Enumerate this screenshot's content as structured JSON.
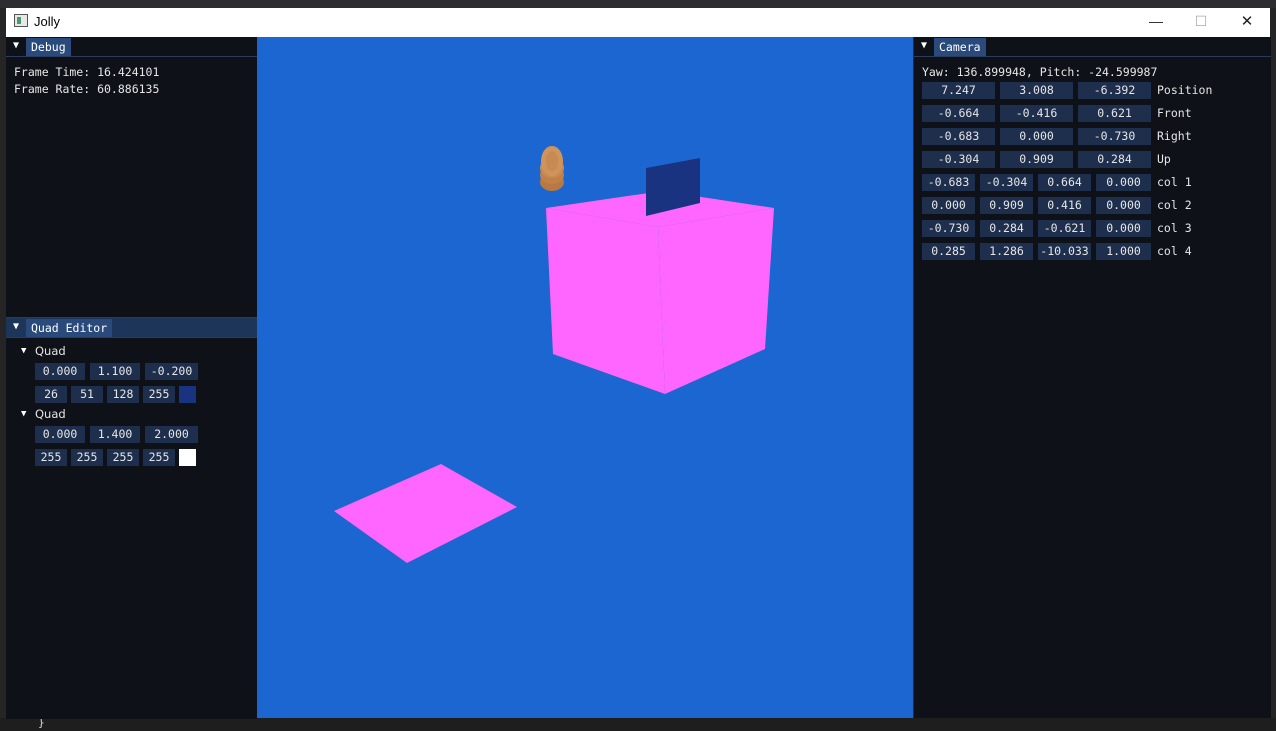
{
  "window": {
    "title": "Jolly",
    "minimize": "—",
    "maximize": "☐",
    "close": "✕"
  },
  "background": {
    "code_fragment": "}"
  },
  "debug": {
    "tab": "Debug",
    "frame_time": "Frame Time: 16.424101",
    "frame_rate": "Frame Rate: 60.886135"
  },
  "quad_editor": {
    "tab": "Quad Editor",
    "quads": [
      {
        "label": "Quad",
        "position": [
          "0.000",
          "1.100",
          "-0.200"
        ],
        "color": [
          "26",
          "51",
          "128",
          "255"
        ],
        "swatch": "#1a3380"
      },
      {
        "label": "Quad",
        "position": [
          "0.000",
          "1.400",
          "2.000"
        ],
        "color": [
          "255",
          "255",
          "255",
          "255"
        ],
        "swatch": "#ffffff"
      }
    ]
  },
  "camera": {
    "tab": "Camera",
    "yaw_pitch": "Yaw: 136.899948, Pitch: -24.599987",
    "vectors": [
      {
        "label": "Position",
        "values": [
          "7.247",
          "3.008",
          "-6.392"
        ]
      },
      {
        "label": "Front",
        "values": [
          "-0.664",
          "-0.416",
          "0.621"
        ]
      },
      {
        "label": "Right",
        "values": [
          "-0.683",
          "0.000",
          "-0.730"
        ]
      },
      {
        "label": "Up",
        "values": [
          "-0.304",
          "0.909",
          "0.284"
        ]
      }
    ],
    "matrix": [
      {
        "label": "col 1",
        "values": [
          "-0.683",
          "-0.304",
          "0.664",
          "0.000"
        ]
      },
      {
        "label": "col 2",
        "values": [
          "0.000",
          "0.909",
          "0.416",
          "0.000"
        ]
      },
      {
        "label": "col 3",
        "values": [
          "-0.730",
          "0.284",
          "-0.621",
          "0.000"
        ]
      },
      {
        "label": "col 4",
        "values": [
          "0.285",
          "1.286",
          "-10.033",
          "1.000"
        ]
      }
    ]
  },
  "scene": {
    "background": "#1b66d1",
    "cube_color": "#ff66ff",
    "quad_color": "#1a3380",
    "plane_color": "#ff66ff"
  }
}
